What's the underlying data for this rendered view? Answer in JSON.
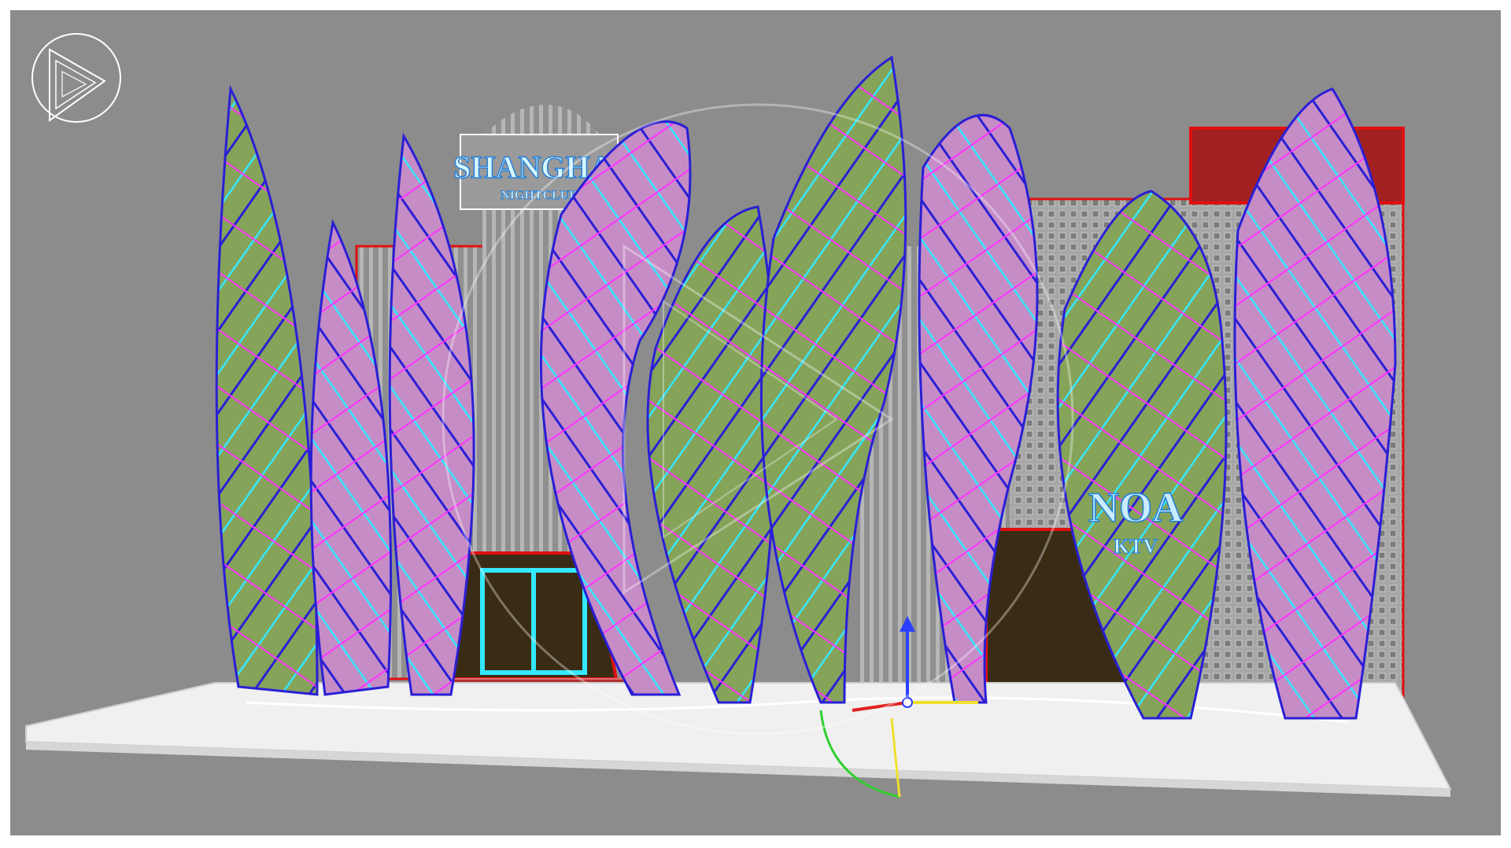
{
  "viewport": {
    "background_color": "#8c8c8c",
    "gizmo_icon": "transform-gizmo-icon",
    "logo_icon": "play-logo-icon",
    "watermark_icon": "watermark-logo-icon"
  },
  "signage": {
    "shanghai_title": "SHANGHAI",
    "shanghai_subtitle": "NIGHTCLUB",
    "noa_title": "NOA",
    "noa_subtitle": "KTV"
  },
  "colors": {
    "green_petal": "#86a35a",
    "pink_petal": "#c68cc6",
    "cyan_wire": "#33e8ff",
    "magenta_wire": "#ff33ff",
    "blue_wire": "#2a1fd6",
    "red_wire": "#e01010",
    "building_grey": "#9a9a9a",
    "ground_white": "#f0f0f0"
  }
}
